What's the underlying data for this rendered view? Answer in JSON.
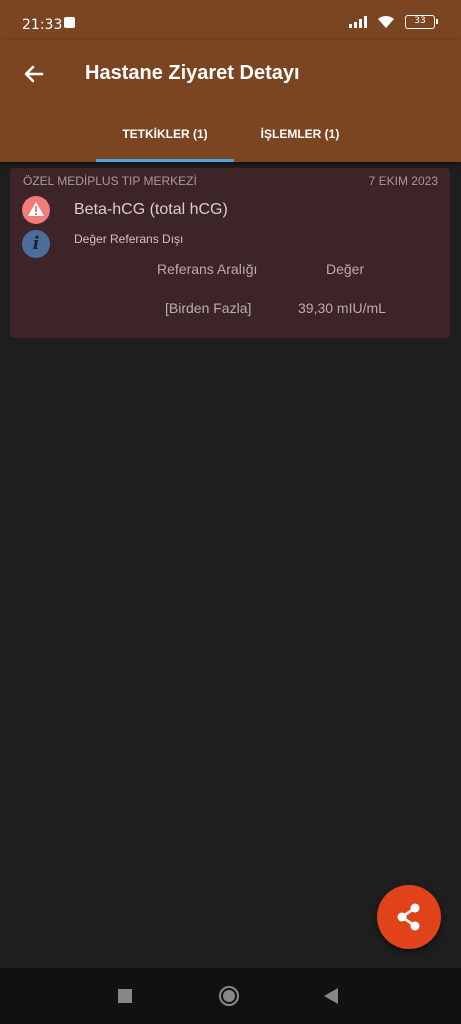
{
  "status_bar": {
    "time": "21:33",
    "battery": "33"
  },
  "app_bar": {
    "title": "Hastane Ziyaret Detayı"
  },
  "tabs": [
    {
      "label": "TETKİKLER (1)",
      "selected": true
    },
    {
      "label": "İŞLEMLER (1)",
      "selected": false
    }
  ],
  "card": {
    "hospital": "ÖZEL MEDİPLUS TIP MERKEZİ",
    "date": "7 EKIM 2023",
    "test_name": "Beta-hCG (total hCG)",
    "status": "Değer Referans Dışı",
    "columns": {
      "reference": "Referans Aralığı",
      "value": "Değer"
    },
    "row": {
      "reference": "[Birden Fazla]",
      "value": "39,30 mIU/mL"
    },
    "info_glyph": "i"
  },
  "colors": {
    "primary": "#7a4520",
    "accent": "#4aa3df",
    "fab": "#e0431a",
    "card_background": "#3d2428",
    "warning": "#f27c7c",
    "info": "#4c6e9a"
  },
  "icons": {
    "back": "arrow-left-icon",
    "warning": "warning-triangle-icon",
    "info": "info-icon",
    "fab": "share-icon"
  }
}
